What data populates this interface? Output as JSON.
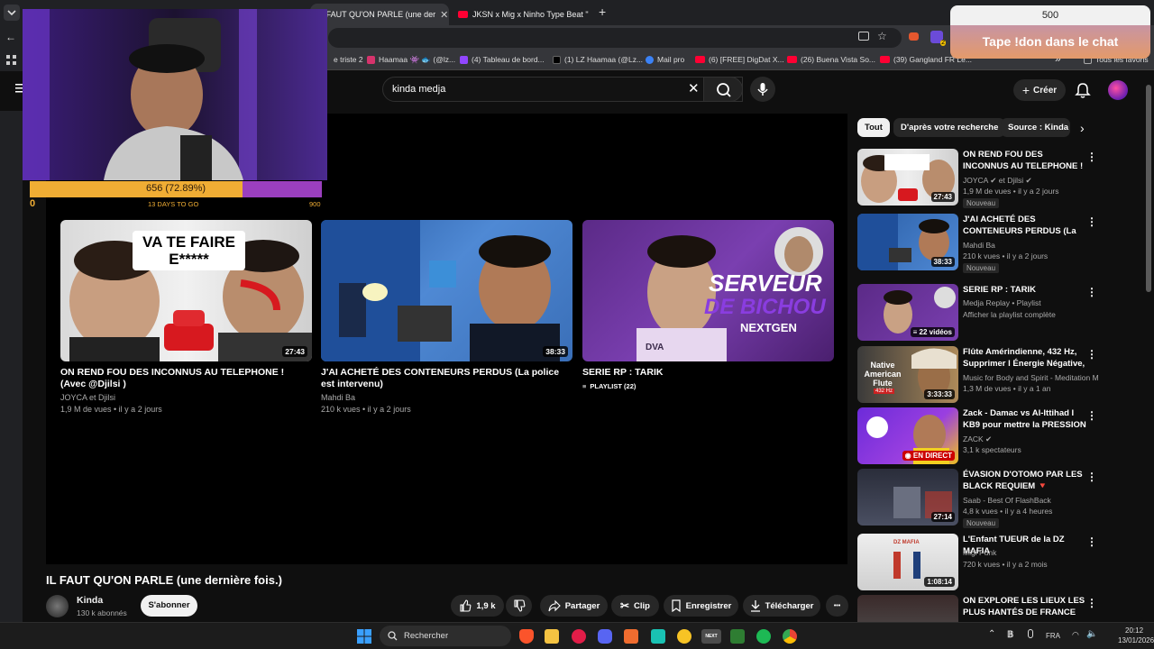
{
  "browser": {
    "tabs": [
      {
        "label": "IL FAUT QU'ON PARLE (une der"
      },
      {
        "label": "JKSN x Mig x Ninho Type Beat \""
      }
    ],
    "bookmarks": [
      "e triste 2",
      "Haamaa 👾 🐟 (@lz...",
      "(4) Tableau de bord...",
      "(1) LZ Haamaa (@Lz...",
      "Mail pro",
      "(6) [FREE] DigDat X...",
      "(26) Buena Vista So...",
      "(39) Gangland FR Le..."
    ],
    "bookmarks_more": "»",
    "all_favorites": "Tous les favoris"
  },
  "youtube": {
    "search_value": "kinda medja",
    "create_label": "Créer",
    "player_cards": [
      {
        "title": "ON REND FOU DES INCONNUS AU TELEPHONE ! (Avec @Djilsi )",
        "channel": "JOYCA et Djilsi",
        "meta": "1,9 M de vues • il y a 2 jours",
        "duration": "27:43",
        "thumb_text": "VA TE FAIRE E*****"
      },
      {
        "title": "J'AI ACHETÉ DES CONTENEURS PERDUS (La police est intervenu)",
        "channel": "Mahdi Ba",
        "meta": "210 k vues • il y a 2 jours",
        "duration": "38:33"
      },
      {
        "title": "SERIE RP : TARIK",
        "playlist": "PLAYLIST (22)",
        "thumb_text_1": "SERVEUR",
        "thumb_text_2": "DE BICHOU",
        "thumb_text_3": "NEXTGEN",
        "thumb_logo": "DVA"
      }
    ],
    "video_title": "IL FAUT QU'ON PARLE (une dernière fois.)",
    "channel": {
      "name": "Kinda",
      "subs": "130 k abonnés",
      "subscribe": "S'abonner"
    },
    "actions": {
      "likes": "1,9 k",
      "share": "Partager",
      "clip": "Clip",
      "save": "Enregistrer",
      "download": "Télécharger",
      "more": "•••"
    },
    "chips": [
      "Tout",
      "D'après votre recherche",
      "Source : Kinda"
    ],
    "sidebar": [
      {
        "title": "ON REND FOU DES INCONNUS AU TELEPHONE ! (Avec @Djilsi )",
        "channel": "JOYCA",
        "channel2": "et Djilsi",
        "meta": "1,9 M de vues • il y a 2 jours",
        "duration": "27:43",
        "badge": "Nouveau"
      },
      {
        "title": "J'AI ACHETÉ DES CONTENEURS PERDUS (La police est ...",
        "channel": "Mahdi Ba",
        "meta": "210 k vues • il y a 2 jours",
        "duration": "38:33",
        "badge": "Nouveau"
      },
      {
        "title": "SERIE RP : TARIK",
        "channel": "Medja Replay • Playlist",
        "meta": "Afficher la playlist complète",
        "duration": "22 vidéos"
      },
      {
        "title": "Flûte Amérindienne, 432 Hz, Supprimer l Énergie Négative, ...",
        "channel": "Music for Body and Spirit - Meditation M...",
        "meta": "1,3 M de vues • il y a 1 an",
        "duration": "3:33:33",
        "thumb_text": "Native American Flute",
        "thumb_sub": "432 Hz"
      },
      {
        "title": "Zack - Damac vs Al-Ittihad I KB9 pour mettre la PRESSION sur ...",
        "channel": "ZACK",
        "meta": "3,1 k spectateurs",
        "duration": "EN DIRECT"
      },
      {
        "title": "ÉVASION D'OTOMO PAR LES BLACK REQUIEM 🔻 L'ARRIVÉ...",
        "channel": "Saab - Best Of FlashBack",
        "meta": "4,8 k vues • il y a 4 heures",
        "duration": "27:14",
        "badge": "Nouveau"
      },
      {
        "title": "L'Enfant TUEUR de la DZ MAFIA",
        "channel": "Migi Punk",
        "meta": "720 k vues • il y a 2 mois",
        "duration": "1:08:14",
        "thumb_text": "DZ MAFIA"
      },
      {
        "title": "ON EXPLORE LES LIEUX LES PLUS HANTÉS DE FRANCE (ft....",
        "channel": "",
        "meta": ""
      }
    ]
  },
  "overlay": {
    "goal": {
      "text": "656 (72.89%)",
      "value": 656,
      "max": 900,
      "percent": 72.89,
      "min_label": "0",
      "max_label": "900",
      "days": "13 DAYS TO GO"
    },
    "don": {
      "count": "500",
      "label": "Tape !don dans le chat"
    }
  },
  "taskbar": {
    "search": "Rechercher",
    "next_label": "NEXT",
    "lang": "FRA",
    "time": "20:12",
    "date": "13/01/2026"
  },
  "colors": {
    "accent": "#ff0033",
    "goal_fill": "#f0ad34",
    "goal_rest": "#9b3fbf"
  }
}
